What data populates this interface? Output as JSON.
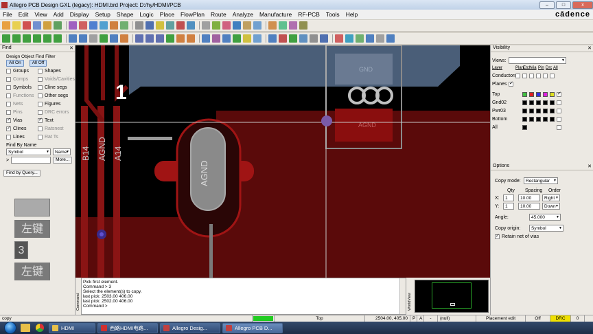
{
  "window": {
    "title": "Allegro PCB Design GXL (legacy): HDMI.brd  Project: D:/hy/HDMI/PCB",
    "min": "–",
    "max": "□",
    "close": "x"
  },
  "menu": [
    "File",
    "Edit",
    "View",
    "Add",
    "Display",
    "Setup",
    "Shape",
    "Logic",
    "Place",
    "FlowPlan",
    "Route",
    "Analyze",
    "Manufacture",
    "RF-PCB",
    "Tools",
    "Help"
  ],
  "brand": "cādence",
  "find": {
    "title": "Find",
    "filter_label": "Design Object Find Filter",
    "all_on": "All On",
    "all_off": "All Off",
    "left": [
      {
        "label": "Groups",
        "on": false,
        "grey": false
      },
      {
        "label": "Comps",
        "on": false,
        "grey": true
      },
      {
        "label": "Symbols",
        "on": false,
        "grey": false
      },
      {
        "label": "Functions",
        "on": false,
        "grey": true
      },
      {
        "label": "Nets",
        "on": false,
        "grey": true
      },
      {
        "label": "Pins",
        "on": false,
        "grey": true
      },
      {
        "label": "Vias",
        "on": true,
        "grey": false
      },
      {
        "label": "Clines",
        "on": true,
        "grey": false
      },
      {
        "label": "Lines",
        "on": false,
        "grey": false
      }
    ],
    "right": [
      {
        "label": "Shapes",
        "on": false,
        "grey": false
      },
      {
        "label": "Voids/Cavities",
        "on": false,
        "grey": true
      },
      {
        "label": "Cline segs",
        "on": false,
        "grey": false
      },
      {
        "label": "Other segs",
        "on": false,
        "grey": false
      },
      {
        "label": "Figures",
        "on": false,
        "grey": false
      },
      {
        "label": "DRC errors",
        "on": false,
        "grey": true
      },
      {
        "label": "Text",
        "on": true,
        "grey": false
      },
      {
        "label": "Ratsnest",
        "on": false,
        "grey": true
      },
      {
        "label": "Rat Ts",
        "on": false,
        "grey": true
      }
    ],
    "by_name_label": "Find By Name",
    "by_name_type": "Symbol",
    "by_name_mode": "Name",
    "arrow": ">",
    "more": "More...",
    "by_query": "Find by Query...",
    "overlay_keys": [
      "左键",
      "3",
      "左键"
    ]
  },
  "board": {
    "labels": [
      "1",
      "B14",
      "AGND",
      "A14",
      "AGND",
      "GND",
      "AGND"
    ]
  },
  "visibility": {
    "title": "Visibility",
    "views_label": "Views:",
    "views_value": "",
    "cols": [
      "Layer",
      "Plan",
      "Etch",
      "Via",
      "Pin",
      "Drc",
      "All"
    ],
    "conductors": "Conductors",
    "planes": "Planes",
    "layers": [
      "Top",
      "Gnd02",
      "Pwr03",
      "Bottom",
      "All"
    ]
  },
  "options": {
    "title": "Options",
    "copy_mode_label": "Copy mode:",
    "copy_mode": "Rectangular",
    "qty": "Qty",
    "spacing": "Spacing",
    "order": "Order",
    "x_label": "X:",
    "x_qty": "1",
    "x_spacing": "10.00",
    "x_order": "Right",
    "y_label": "Y:",
    "y_qty": "1",
    "y_spacing": "10.00",
    "y_order": "Down",
    "angle_label": "Angle:",
    "angle": "45.000",
    "origin_label": "Copy origin:",
    "origin": "Symbol",
    "retain_label": "Retain net of vias"
  },
  "command": {
    "side_label": "Command",
    "lines": [
      "Pick first element.",
      "Command > 3",
      "Select the element(s) to copy.",
      "last pick:  2503.00 406.00",
      "last pick:  2502.00 406.00",
      "Command >"
    ]
  },
  "worldview_label": "WorldView",
  "status": {
    "mode": "copy",
    "layer": "Top",
    "coords": "2504.00, 405.00",
    "p": "P",
    "a": "A",
    "sep": "-",
    "null": "(null)",
    "edit": "Placement edit",
    "off": "Off",
    "drc": "DRC",
    "zero": "0"
  },
  "taskbar": [
    {
      "label": "HDMI",
      "color": "#e8c04a"
    },
    {
      "label": "西路HDMI电路...",
      "color": "#d03030"
    },
    {
      "label": "Allegro Desig...",
      "color": "#c04040"
    },
    {
      "label": "Allegro PCB D...",
      "color": "#c04040"
    }
  ]
}
